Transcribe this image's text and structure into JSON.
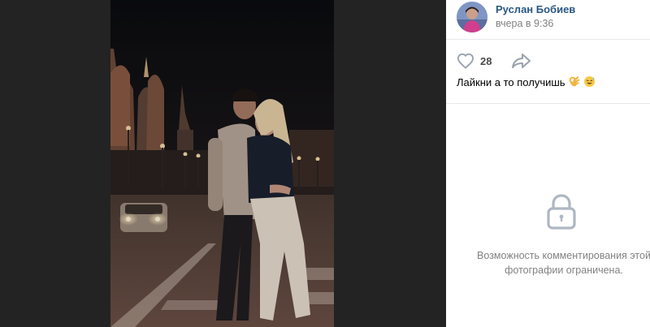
{
  "post": {
    "author_name": "Руслан Бобиев",
    "date": "вчера в 9:36",
    "likes_count": "28",
    "caption": "Лайкни а то получишь"
  },
  "icons": {
    "like": "heart-outline-icon",
    "share": "share-arrow-icon",
    "lock": "lock-icon",
    "caption_emojis": [
      "ok-hand-emoji",
      "sweat-smile-emoji"
    ]
  },
  "comments": {
    "restricted_text": "Возможность комментирования этой фотографии ограничена."
  },
  "colors": {
    "author_link": "#2a5885",
    "secondary_text": "#828282",
    "backdrop": "#232323",
    "icon_gray": "#99a2ad"
  }
}
